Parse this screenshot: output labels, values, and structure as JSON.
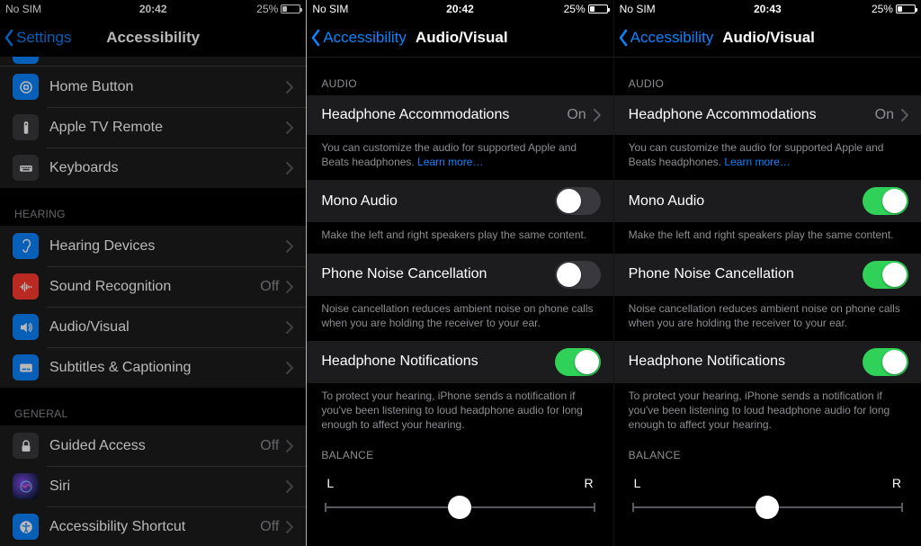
{
  "status": {
    "carrier": "No SIM",
    "battery_pct": "25%",
    "battery_fill_pct": 25
  },
  "times": {
    "p1": "20:42",
    "p2": "20:42",
    "p3": "20:43"
  },
  "pane1": {
    "back_label": "Settings",
    "title": "Accessibility",
    "group1": [
      {
        "icon": "home-button",
        "color": "#0a84ff",
        "label": "Home Button"
      },
      {
        "icon": "apple-tv-remote",
        "color": "#3a3a3c",
        "label": "Apple TV Remote"
      },
      {
        "icon": "keyboards",
        "color": "#3a3a3c",
        "label": "Keyboards"
      }
    ],
    "hearing_header": "HEARING",
    "hearing": [
      {
        "icon": "hearing-devices",
        "color": "#0a84ff",
        "label": "Hearing Devices"
      },
      {
        "icon": "sound-recognition",
        "color": "#ff3b30",
        "label": "Sound Recognition",
        "value": "Off"
      },
      {
        "icon": "audio-visual",
        "color": "#0a84ff",
        "label": "Audio/Visual"
      },
      {
        "icon": "subtitles",
        "color": "#0a84ff",
        "label": "Subtitles & Captioning"
      }
    ],
    "general_header": "GENERAL",
    "general": [
      {
        "icon": "guided-access",
        "color": "#3a3a3c",
        "label": "Guided Access",
        "value": "Off"
      },
      {
        "icon": "siri",
        "color": "#1c1c1e",
        "label": "Siri"
      },
      {
        "icon": "accessibility-shortcut",
        "color": "#0a84ff",
        "label": "Accessibility Shortcut",
        "value": "Off"
      }
    ]
  },
  "av": {
    "back_label": "Accessibility",
    "title": "Audio/Visual",
    "audio_header": "AUDIO",
    "headphone_accom": {
      "label": "Headphone Accommodations",
      "value": "On"
    },
    "headphone_accom_footer_pre": "You can customize the audio for supported Apple and Beats headphones. ",
    "headphone_accom_footer_link": "Learn more…",
    "mono": {
      "label": "Mono Audio"
    },
    "mono_footer": "Make the left and right speakers play the same content.",
    "pnc": {
      "label": "Phone Noise Cancellation"
    },
    "pnc_footer": "Noise cancellation reduces ambient noise on phone calls when you are holding the receiver to your ear.",
    "hn": {
      "label": "Headphone Notifications"
    },
    "hn_footer": "To protect your hearing, iPhone sends a notification if you've been listening to loud headphone audio for long enough to affect your hearing.",
    "balance_header": "BALANCE",
    "balance": {
      "left": "L",
      "right": "R",
      "value": 0.5
    }
  },
  "toggles": {
    "p2": {
      "mono": false,
      "pnc": false,
      "hn": true
    },
    "p3": {
      "mono": true,
      "pnc": true,
      "hn": true
    }
  }
}
